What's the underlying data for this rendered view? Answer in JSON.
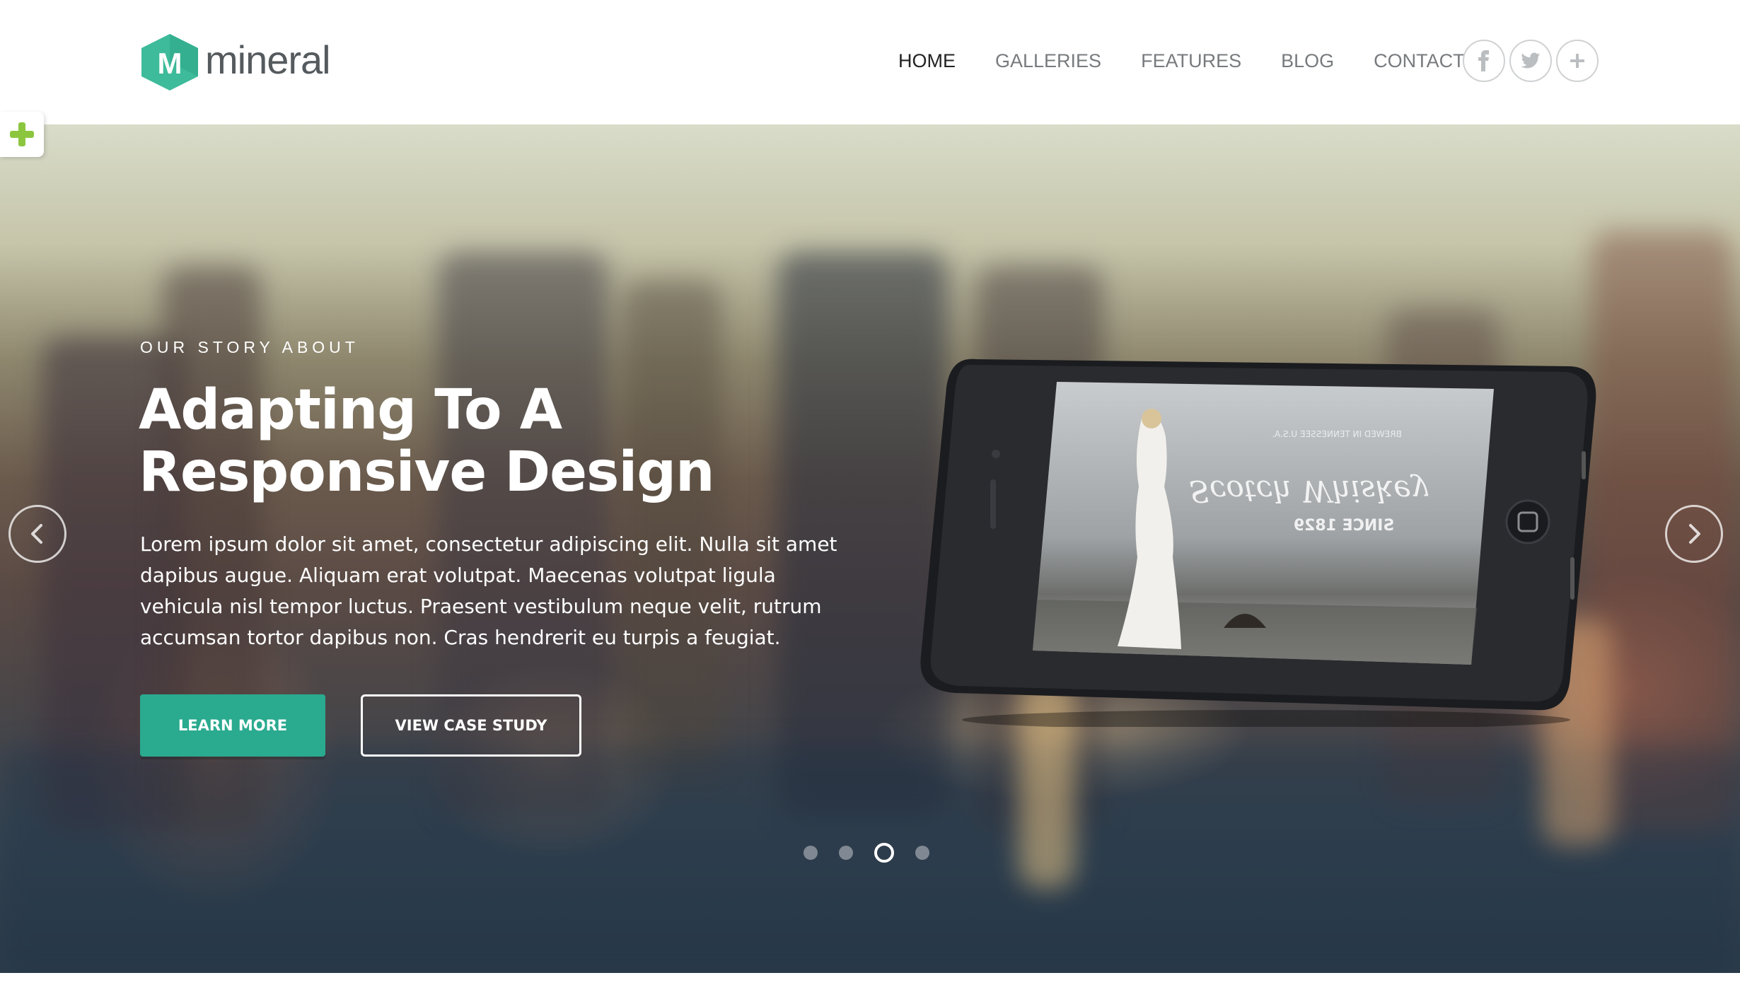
{
  "brand": {
    "logo_letter": "M",
    "name": "mineral",
    "accent": "#2aaa8f"
  },
  "nav": {
    "items": [
      {
        "label": "HOME",
        "active": true
      },
      {
        "label": "GALLERIES",
        "active": false
      },
      {
        "label": "FEATURES",
        "active": false
      },
      {
        "label": "BLOG",
        "active": false
      },
      {
        "label": "CONTACT",
        "active": false
      }
    ],
    "socials": [
      {
        "icon": "facebook-icon",
        "glyph": "f"
      },
      {
        "icon": "twitter-icon",
        "glyph": "t"
      },
      {
        "icon": "plus-icon",
        "glyph": "+"
      }
    ]
  },
  "hero": {
    "eyebrow": "OUR STORY ABOUT",
    "headline": "Adapting To A Responsive Design",
    "body": "Lorem ipsum dolor sit amet, consectetur adipiscing elit. Nulla sit amet dapibus augue. Aliquam erat volutpat. Maecenas volutpat ligula vehicula nisl tempor luctus. Praesent vestibulum neque velit, rutrum accumsan tortor dapibus non. Cras hendrerit eu turpis a feugiat.",
    "primary_button": "LEARN MORE",
    "secondary_button": "VIEW CASE STUDY",
    "slides_total": 4,
    "active_slide": 3
  },
  "phone_screen": {
    "script_text": "Scotch Whiskey",
    "since_text": "SINCE 1829",
    "top_text": "BREWED IN TENNESSEE U.S.A."
  }
}
